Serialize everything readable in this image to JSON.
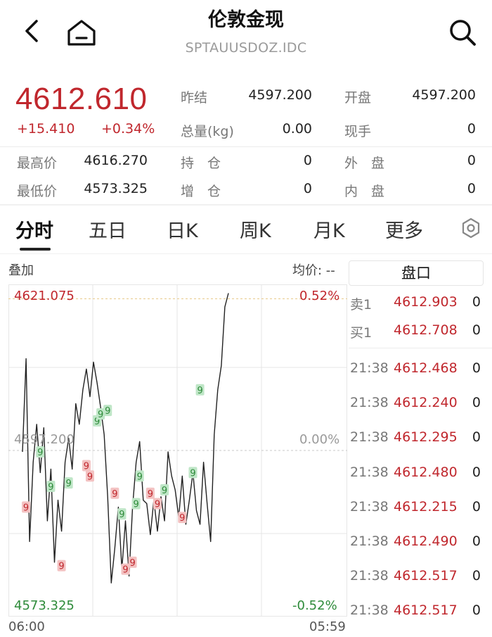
{
  "header": {
    "title": "伦敦金现",
    "symbol": "SPTAUUSDOZ.IDC"
  },
  "quote": {
    "price": "4612.610",
    "change": "+15.410",
    "change_pct": "+0.34%",
    "stats": [
      {
        "label": "昨结",
        "value": "4597.200"
      },
      {
        "label": "开盘",
        "value": "4597.200"
      },
      {
        "label": "总量(kg)",
        "value": "0.00"
      },
      {
        "label": "现手",
        "value": "0"
      },
      {
        "label": "最高价",
        "value": "4616.270"
      },
      {
        "label": "持　仓",
        "value": "0"
      },
      {
        "label": "外　盘",
        "value": "0"
      },
      {
        "label": "最低价",
        "value": "4573.325"
      },
      {
        "label": "增　仓",
        "value": "0"
      },
      {
        "label": "内　盘",
        "value": "0"
      }
    ]
  },
  "tabs": [
    "分时",
    "五日",
    "日K",
    "周K",
    "月K",
    "更多"
  ],
  "active_tab": "分时",
  "chart_toolbar": {
    "overlay": "叠加",
    "avg_price": "均价: --"
  },
  "chart_data": {
    "type": "line",
    "xlabel": "",
    "ylabel": "",
    "x_ticks": [
      "06:00",
      "05:59"
    ],
    "y_left_ticks": [
      "4621.075",
      "4597.200",
      "4573.325"
    ],
    "y_right_ticks": [
      "0.52%",
      "0.00%",
      "-0.52%"
    ],
    "ylim": [
      4573.325,
      4621.075
    ],
    "reference": 4597.2,
    "series": [
      {
        "values": [
          4597.0,
          4610.5,
          4584.0,
          4595.5,
          4601.0,
          4594.0,
          4600.5,
          4587.0,
          4594.5,
          4581.0,
          4590.0,
          4585.5,
          4595.5,
          4599.0,
          4594.5,
          4604.0,
          4601.0,
          4606.0,
          4609.0,
          4605.0,
          4610.0,
          4607.0,
          4603.5,
          4599.5,
          4590.5,
          4578.0,
          4583.0,
          4589.0,
          4580.0,
          4587.0,
          4579.0,
          4589.0,
          4595.5,
          4598.5,
          4590.0,
          4589.5,
          4585.0,
          4590.0,
          4585.5,
          4590.5,
          4587.0,
          4597.0,
          4593.5,
          4591.5,
          4587.5,
          4593.5,
          4586.5,
          4590.0,
          4594.0,
          4588.5,
          4586.5,
          4595.5,
          4589.5,
          4584.0,
          4599.5,
          4606.0,
          4609.5,
          4618.0,
          4620.0
        ]
      }
    ],
    "markers": [
      {
        "x": 1,
        "value": 4589.0,
        "kind": "sell"
      },
      {
        "x": 5,
        "value": 4597.0,
        "kind": "buy"
      },
      {
        "x": 8,
        "value": 4592.0,
        "kind": "buy"
      },
      {
        "x": 11,
        "value": 4580.5,
        "kind": "sell"
      },
      {
        "x": 13,
        "value": 4592.5,
        "kind": "buy"
      },
      {
        "x": 18,
        "value": 4595.0,
        "kind": "sell"
      },
      {
        "x": 19,
        "value": 4593.5,
        "kind": "sell"
      },
      {
        "x": 21,
        "value": 4601.5,
        "kind": "buy"
      },
      {
        "x": 22,
        "value": 4602.5,
        "kind": "buy"
      },
      {
        "x": 24,
        "value": 4603.0,
        "kind": "buy"
      },
      {
        "x": 26,
        "value": 4591.0,
        "kind": "sell"
      },
      {
        "x": 28,
        "value": 4588.0,
        "kind": "buy"
      },
      {
        "x": 29,
        "value": 4580.0,
        "kind": "sell"
      },
      {
        "x": 31,
        "value": 4581.0,
        "kind": "sell"
      },
      {
        "x": 32,
        "value": 4589.5,
        "kind": "buy"
      },
      {
        "x": 33,
        "value": 4593.5,
        "kind": "buy"
      },
      {
        "x": 36,
        "value": 4591.0,
        "kind": "sell"
      },
      {
        "x": 38,
        "value": 4589.5,
        "kind": "sell"
      },
      {
        "x": 40,
        "value": 4591.5,
        "kind": "buy"
      },
      {
        "x": 45,
        "value": 4587.5,
        "kind": "sell"
      },
      {
        "x": 48,
        "value": 4594.0,
        "kind": "buy"
      },
      {
        "x": 50,
        "value": 4606.0,
        "kind": "buy"
      }
    ],
    "marker_label": "9"
  },
  "order_book": {
    "title": "盘口",
    "levels": [
      {
        "label": "卖1",
        "price": "4612.903",
        "volume": "0"
      },
      {
        "label": "买1",
        "price": "4612.708",
        "volume": "0"
      }
    ],
    "ticks": [
      {
        "time": "21:38",
        "price": "4612.468",
        "volume": "0"
      },
      {
        "time": "21:38",
        "price": "4612.240",
        "volume": "0"
      },
      {
        "time": "21:38",
        "price": "4612.295",
        "volume": "0"
      },
      {
        "time": "21:38",
        "price": "4612.480",
        "volume": "0"
      },
      {
        "time": "21:38",
        "price": "4612.215",
        "volume": "0"
      },
      {
        "time": "21:38",
        "price": "4612.490",
        "volume": "0"
      },
      {
        "time": "21:38",
        "price": "4612.517",
        "volume": "0"
      },
      {
        "time": "21:38",
        "price": "4612.517",
        "volume": "0"
      }
    ]
  },
  "colors": {
    "up": "#c0272d",
    "down": "#2e8b3a",
    "line": "#222222",
    "grid": "#e6e6e6"
  },
  "icons": [
    "back-arrow-icon",
    "home-icon",
    "search-icon",
    "settings-hexagon-icon"
  ]
}
